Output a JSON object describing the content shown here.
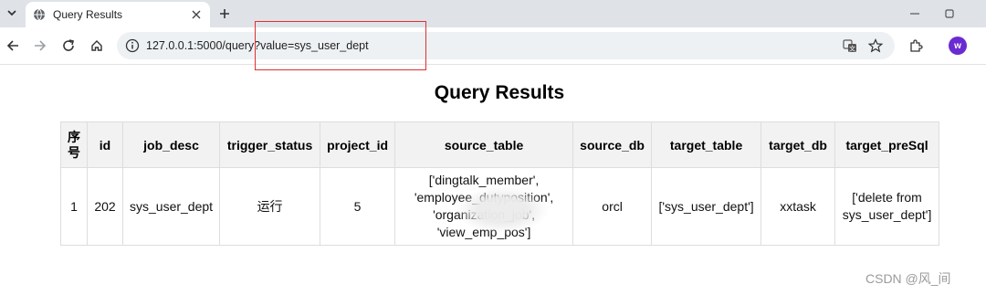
{
  "tab": {
    "title": "Query Results"
  },
  "address_bar": {
    "url": "127.0.0.1:5000/query?value=sys_user_dept"
  },
  "profile": {
    "initial": "w",
    "color": "#6a2bd1"
  },
  "page": {
    "title": "Query Results",
    "table": {
      "headers": [
        "序号",
        "id",
        "job_desc",
        "trigger_status",
        "project_id",
        "source_table",
        "source_db",
        "target_table",
        "target_db",
        "target_preSql"
      ],
      "rows": [
        [
          "1",
          "202",
          "sys_user_dept",
          "运行",
          "5",
          "['dingtalk_member', 'employee_dutyposition', 'organization_job', 'view_emp_pos']",
          "orcl",
          "['sys_user_dept']",
          "xxtask",
          "['delete from sys_user_dept']"
        ]
      ]
    }
  },
  "watermark": "CSDN @风_间",
  "colors": {
    "highlight": "#e03030",
    "tabstrip": "#dfe3e8",
    "omnibox": "#eef1f4"
  },
  "icons": [
    "tab-search-icon",
    "globe-icon",
    "close-icon",
    "plus-icon",
    "minimize-icon",
    "maximize-icon",
    "back-arrow-icon",
    "forward-arrow-icon",
    "reload-icon",
    "home-icon",
    "info-icon",
    "translate-icon",
    "star-icon",
    "extensions-icon"
  ]
}
